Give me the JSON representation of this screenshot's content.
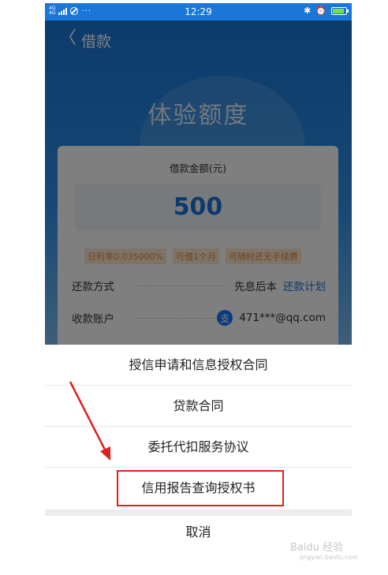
{
  "status_bar": {
    "network_top": "4G",
    "network_bottom": "4G",
    "dots": "···",
    "time": "12:29",
    "bluetooth_glyph": "✱",
    "alarm_glyph": "⏰"
  },
  "header": {
    "back_glyph": "〈",
    "title": "借款"
  },
  "hero": {
    "title": "体验额度"
  },
  "loan_card": {
    "amount_label": "借款金额(元)",
    "amount_value": "500",
    "tags": [
      "日利率0.035000%",
      "可借1个月",
      "可随时还无手续费"
    ],
    "repayment": {
      "label": "还款方式",
      "value": "先息后本",
      "link": "还款计划"
    },
    "account": {
      "label": "收款账户",
      "icon_glyph": "支",
      "value": "471***@qq.com"
    }
  },
  "action_sheet": {
    "items": [
      "授信申请和信息授权合同",
      "贷款合同",
      "委托代扣服务协议",
      "信用报告查询授权书"
    ],
    "cancel": "取消"
  },
  "watermark": {
    "text": "Baidu 经验",
    "sub": "jingyan.baidu.com"
  },
  "colors": {
    "brand_blue": "#1877d8",
    "annotation_red": "#e02020",
    "tag_bg": "#fde7cf",
    "tag_text": "#e08a3a"
  }
}
